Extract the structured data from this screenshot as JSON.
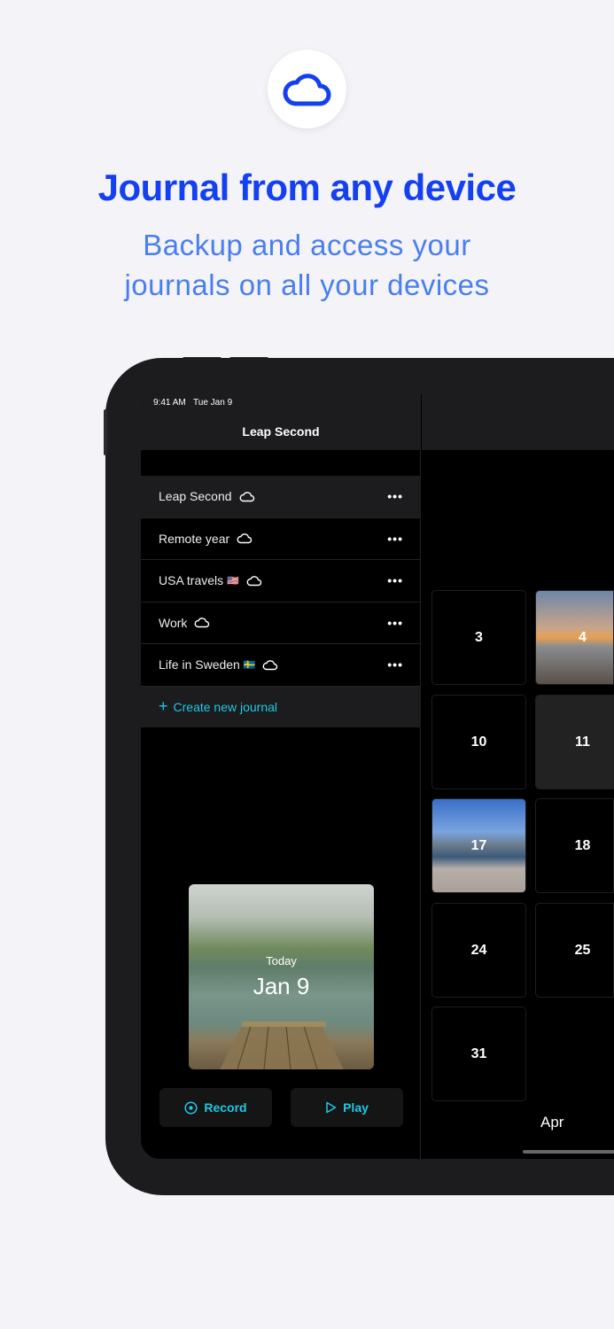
{
  "hero": {
    "icon": "cloud-icon",
    "title": "Journal from any device",
    "subtitle_line1": "Backup and access your",
    "subtitle_line2": "journals on all your devices",
    "accent": "#1440f0"
  },
  "status": {
    "time": "9:41 AM",
    "date": "Tue Jan 9"
  },
  "nav": {
    "title": "Leap Second"
  },
  "journals": [
    {
      "name": "Leap Second",
      "flag": "",
      "selected": true
    },
    {
      "name": "Remote year",
      "flag": ""
    },
    {
      "name": "USA travels",
      "flag": "🇺🇸"
    },
    {
      "name": "Work",
      "flag": ""
    },
    {
      "name": "Life in Sweden",
      "flag": "🇸🇪"
    }
  ],
  "more_label": "•••",
  "create": {
    "icon": "plus-icon",
    "label": "Create new journal"
  },
  "today": {
    "label": "Today",
    "date": "Jan 9"
  },
  "buttons": {
    "record": "Record",
    "play": "Play"
  },
  "calendar": {
    "days": [
      "3",
      "4",
      "10",
      "11",
      "17",
      "18",
      "24",
      "25",
      "31"
    ],
    "next_month": "Apr"
  }
}
